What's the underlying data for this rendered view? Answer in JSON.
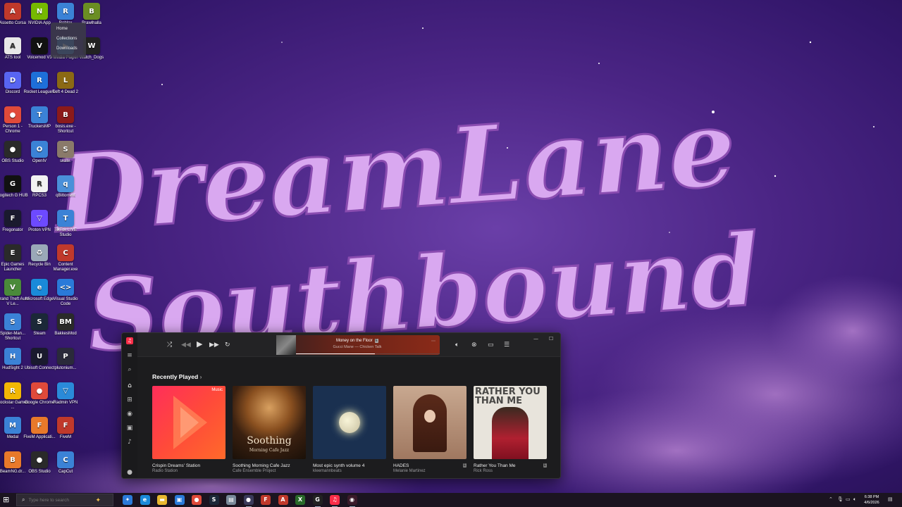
{
  "wallpaper": {
    "line1": "DreamLane",
    "line2": "Southbound",
    "text_color": "#d9a8f0"
  },
  "desktop_icons": [
    {
      "label": "Assetto Corsa",
      "icon": "assetto-corsa-icon",
      "color": "#c0392b",
      "glyph": "A"
    },
    {
      "label": "NVIDIA App",
      "icon": "nvidia-icon",
      "color": "#76b900",
      "glyph": "N"
    },
    {
      "label": "Roblox",
      "icon": "roblox-icon",
      "color": "#3b82d6",
      "glyph": "R"
    },
    {
      "label": "Brawlhalla",
      "icon": "brawlhalla-icon",
      "color": "#6b8e23",
      "glyph": "B"
    },
    {
      "label": "ATS tool",
      "icon": "ats-tool-icon",
      "color": "#e8e8e8",
      "glyph": "A"
    },
    {
      "label": "Voicemod V3",
      "icon": "voicemod-icon",
      "color": "#111111",
      "glyph": "V"
    },
    {
      "label": "Media Player",
      "icon": "media-player-icon",
      "color": "#3b82d6",
      "glyph": "▶"
    },
    {
      "label": "Watch_Dogs",
      "icon": "watch-dogs-icon",
      "color": "#222222",
      "glyph": "W"
    },
    {
      "label": "Discord",
      "icon": "discord-icon",
      "color": "#5865f2",
      "glyph": "D"
    },
    {
      "label": "Rocket League®",
      "icon": "rocket-league-icon",
      "color": "#1e6fd9",
      "glyph": "R"
    },
    {
      "label": "Left 4 Dead 2",
      "icon": "left-4-dead-icon",
      "color": "#8b6914",
      "glyph": "L"
    },
    {
      "label": "Person 1 - Chrome",
      "icon": "chrome-icon",
      "color": "#e04a3a",
      "glyph": "●"
    },
    {
      "label": "TruckersMP",
      "icon": "truckersmp-icon",
      "color": "#3b82d6",
      "glyph": "T"
    },
    {
      "label": "bosis.exe - Shortcut",
      "icon": "bosis-icon",
      "color": "#8b1a1a",
      "glyph": "B"
    },
    {
      "label": "OBS Studio",
      "icon": "obs-icon",
      "color": "#2a2a2a",
      "glyph": "●"
    },
    {
      "label": "OpenIV",
      "icon": "openiv-icon",
      "color": "#3b82d6",
      "glyph": "O"
    },
    {
      "label": "skate.",
      "icon": "skate-icon",
      "color": "#8a7a6a",
      "glyph": "S"
    },
    {
      "label": "Logitech G HUB",
      "icon": "logitech-icon",
      "color": "#111111",
      "glyph": "G"
    },
    {
      "label": "RPCS3",
      "icon": "rpcs3-icon",
      "color": "#f2f2f2",
      "glyph": "R"
    },
    {
      "label": "qBittorrent",
      "icon": "qbittorrent-icon",
      "color": "#4a90d9",
      "glyph": "q"
    },
    {
      "label": "Fregonator",
      "icon": "fregonator-icon",
      "color": "#1a1a2e",
      "glyph": "F"
    },
    {
      "label": "Proton VPN",
      "icon": "proton-vpn-icon",
      "color": "#6d4aff",
      "glyph": "▽"
    },
    {
      "label": "TikTok LIVE Studio",
      "icon": "tiktok-icon",
      "color": "#3b82d6",
      "glyph": "T"
    },
    {
      "label": "Epic Games Launcher",
      "icon": "epic-games-icon",
      "color": "#2a2a2a",
      "glyph": "E"
    },
    {
      "label": "Recycle Bin",
      "icon": "recycle-bin-icon",
      "color": "#9aa8b8",
      "glyph": "♻"
    },
    {
      "label": "Content Manager.exe",
      "icon": "content-manager-icon",
      "color": "#c0392b",
      "glyph": "C"
    },
    {
      "label": "Grand Theft Auto V Le...",
      "icon": "gta-icon",
      "color": "#4a8a3a",
      "glyph": "V"
    },
    {
      "label": "Microsoft Edge",
      "icon": "edge-icon",
      "color": "#1a8ad9",
      "glyph": "e"
    },
    {
      "label": "Visual Studio Code",
      "icon": "vscode-icon",
      "color": "#2a7ad9",
      "glyph": "<>"
    },
    {
      "label": "Spider-Man... Shortcut",
      "icon": "spiderman-icon",
      "color": "#3b82d6",
      "glyph": "S"
    },
    {
      "label": "Steam",
      "icon": "steam-icon",
      "color": "#1b2838",
      "glyph": "S"
    },
    {
      "label": "BakkesMod",
      "icon": "bakkesmod-icon",
      "color": "#2a2a2a",
      "glyph": "BM"
    },
    {
      "label": "HudSight 2",
      "icon": "hudsight-icon",
      "color": "#3b82d6",
      "glyph": "H"
    },
    {
      "label": "Ubisoft Connect",
      "icon": "ubisoft-icon",
      "color": "#1a1a2e",
      "glyph": "U"
    },
    {
      "label": "plutonium...",
      "icon": "plutonium-icon",
      "color": "#2a2a3a",
      "glyph": "P"
    },
    {
      "label": "Rockstar Games ...",
      "icon": "rockstar-icon",
      "color": "#f2b705",
      "glyph": "R"
    },
    {
      "label": "Google Chrome",
      "icon": "chrome-icon",
      "color": "#e04a3a",
      "glyph": "●"
    },
    {
      "label": "Radmin VPN",
      "icon": "radmin-vpn-icon",
      "color": "#2a8ad9",
      "glyph": "▽"
    },
    {
      "label": "Medal",
      "icon": "medal-icon",
      "color": "#3b82d6",
      "glyph": "M"
    },
    {
      "label": "FiveM Applicati...",
      "icon": "fivem-app-icon",
      "color": "#e8792a",
      "glyph": "F"
    },
    {
      "label": "FiveM",
      "icon": "fivem-icon",
      "color": "#c0392b",
      "glyph": "F"
    },
    {
      "label": "BeamNG.dr...",
      "icon": "beamng-icon",
      "color": "#e8792a",
      "glyph": "B"
    },
    {
      "label": "OBS Studio",
      "icon": "obs-icon",
      "color": "#2a2a2a",
      "glyph": "●"
    },
    {
      "label": "CapCut",
      "icon": "capcut-icon",
      "color": "#3b82d6",
      "glyph": "C"
    }
  ],
  "context_menu": [
    "Home",
    "Collections",
    "Downloads"
  ],
  "music_app": {
    "now_playing": {
      "title": "Money on the Floor",
      "subtitle": "Gucci Mane — Chicken Talk",
      "progress": 0.55
    },
    "section_title": "Recently Played",
    "albums": [
      {
        "title": "Crispin Dreams' Station",
        "subtitle": "Radio Station",
        "art": "apple-music-station",
        "badge": "Music",
        "explicit": false
      },
      {
        "title": "Soothing Morning Cafe Jazz",
        "subtitle": "Cafe Ensemble Project",
        "art": "coffee-cup",
        "art_text": "Soothing",
        "art_subtext": "Morning Cafe Jazz",
        "explicit": false
      },
      {
        "title": "Most epic synth volume 4",
        "subtitle": "kleemannbeats",
        "art": "moon",
        "explicit": false
      },
      {
        "title": "HADES",
        "subtitle": "Melanie Martinez",
        "art": "hades",
        "explicit": true
      },
      {
        "title": "Rather You Than Me",
        "subtitle": "Rick Ross",
        "art": "rick-ross",
        "art_text": "RATHER YOU THAN ME",
        "explicit": true
      }
    ]
  },
  "taskbar": {
    "search_placeholder": "Type here to search",
    "apps": [
      {
        "icon": "copilot-icon",
        "color": "#2a7ad9",
        "glyph": "✦",
        "active": false
      },
      {
        "icon": "edge-icon",
        "color": "#1a8ad9",
        "glyph": "e",
        "active": false
      },
      {
        "icon": "file-explorer-icon",
        "color": "#e8b830",
        "glyph": "▬",
        "active": false
      },
      {
        "icon": "store-icon",
        "color": "#2a7ad9",
        "glyph": "▣",
        "active": false
      },
      {
        "icon": "chrome-icon",
        "color": "#e04a3a",
        "glyph": "●",
        "active": false
      },
      {
        "icon": "steam-icon",
        "color": "#1b2838",
        "glyph": "S",
        "active": false
      },
      {
        "icon": "files-icon",
        "color": "#7a8a9a",
        "glyph": "▤",
        "active": false
      },
      {
        "icon": "obs-icon",
        "color": "#3a3a5a",
        "glyph": "●",
        "active": true
      },
      {
        "icon": "fivem-icon",
        "color": "#c0392b",
        "glyph": "F",
        "active": false
      },
      {
        "icon": "acrobat-icon",
        "color": "#c0392b",
        "glyph": "A",
        "active": false
      },
      {
        "icon": "xbox-icon",
        "color": "#2a6a2a",
        "glyph": "X",
        "active": false
      },
      {
        "icon": "logitech-icon",
        "color": "#222222",
        "glyph": "G",
        "active": true
      },
      {
        "icon": "apple-music-icon",
        "color": "#fa2d48",
        "glyph": "♫",
        "active": true
      },
      {
        "icon": "recorder-icon",
        "color": "#3a1a2a",
        "glyph": "◉",
        "active": true
      }
    ],
    "clock_time": "6:38 PM",
    "clock_date": "4/6/2026"
  }
}
